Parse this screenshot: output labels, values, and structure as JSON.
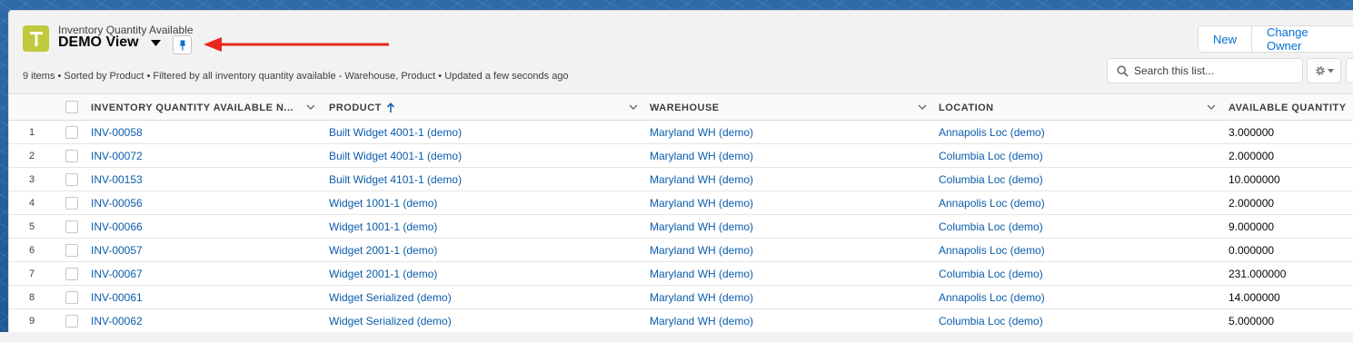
{
  "header": {
    "object_label": "Inventory Quantity Available",
    "view_title": "DEMO View",
    "meta": "9 items • Sorted by Product • Filtered by all inventory quantity available - Warehouse, Product • Updated a few seconds ago",
    "search_placeholder": "Search this list...",
    "buttons": {
      "new": "New",
      "change_owner": "Change Owner"
    },
    "accent_color": "#c0c93c",
    "annotation_arrow_color": "#e8261d"
  },
  "columns": {
    "name": "INVENTORY QUANTITY AVAILABLE N...",
    "product": "PRODUCT",
    "warehouse": "WAREHOUSE",
    "location": "LOCATION",
    "quantity": "AVAILABLE QUANTITY"
  },
  "rows": [
    {
      "num": "1",
      "name": "INV-00058",
      "product": "Built Widget 4001-1 (demo)",
      "warehouse": "Maryland WH (demo)",
      "location": "Annapolis Loc (demo)",
      "quantity": "3.000000"
    },
    {
      "num": "2",
      "name": "INV-00072",
      "product": "Built Widget 4001-1 (demo)",
      "warehouse": "Maryland WH (demo)",
      "location": "Columbia Loc (demo)",
      "quantity": "2.000000"
    },
    {
      "num": "3",
      "name": "INV-00153",
      "product": "Built Widget 4101-1 (demo)",
      "warehouse": "Maryland WH (demo)",
      "location": "Columbia Loc (demo)",
      "quantity": "10.000000"
    },
    {
      "num": "4",
      "name": "INV-00056",
      "product": "Widget 1001-1 (demo)",
      "warehouse": "Maryland WH (demo)",
      "location": "Annapolis Loc (demo)",
      "quantity": "2.000000"
    },
    {
      "num": "5",
      "name": "INV-00066",
      "product": "Widget 1001-1 (demo)",
      "warehouse": "Maryland WH (demo)",
      "location": "Columbia Loc (demo)",
      "quantity": "9.000000"
    },
    {
      "num": "6",
      "name": "INV-00057",
      "product": "Widget 2001-1 (demo)",
      "warehouse": "Maryland WH (demo)",
      "location": "Annapolis Loc (demo)",
      "quantity": "0.000000"
    },
    {
      "num": "7",
      "name": "INV-00067",
      "product": "Widget 2001-1 (demo)",
      "warehouse": "Maryland WH (demo)",
      "location": "Columbia Loc (demo)",
      "quantity": "231.000000"
    },
    {
      "num": "8",
      "name": "INV-00061",
      "product": "Widget Serialized (demo)",
      "warehouse": "Maryland WH (demo)",
      "location": "Annapolis Loc (demo)",
      "quantity": "14.000000"
    },
    {
      "num": "9",
      "name": "INV-00062",
      "product": "Widget Serialized (demo)",
      "warehouse": "Maryland WH (demo)",
      "location": "Columbia Loc (demo)",
      "quantity": "5.000000"
    }
  ]
}
